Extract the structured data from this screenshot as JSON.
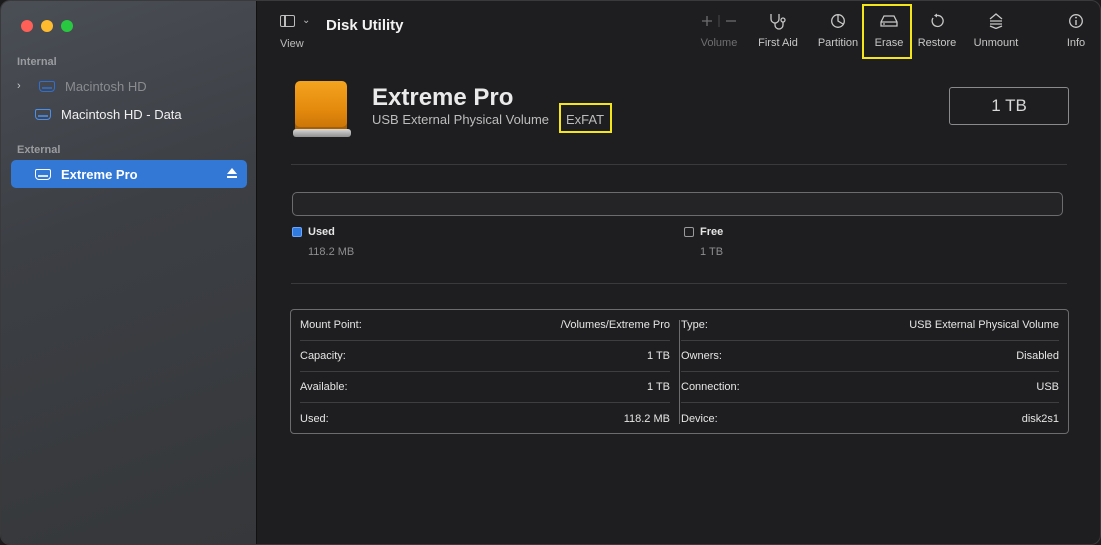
{
  "app": {
    "title": "Disk Utility"
  },
  "toolbar": {
    "view_label": "View",
    "volume_label": "Volume",
    "first_aid_label": "First Aid",
    "partition_label": "Partition",
    "erase_label": "Erase",
    "restore_label": "Restore",
    "unmount_label": "Unmount",
    "info_label": "Info"
  },
  "sidebar": {
    "internal_label": "Internal",
    "external_label": "External",
    "items": {
      "macintosh_hd": "Macintosh HD",
      "macintosh_hd_data": "Macintosh HD - Data",
      "extreme_pro": "Extreme Pro"
    }
  },
  "volume": {
    "name": "Extreme Pro",
    "subtitle": "USB External Physical Volume",
    "filesystem": "ExFAT",
    "capacity": "1 TB"
  },
  "usage": {
    "used_label": "Used",
    "used_value": "118.2 MB",
    "free_label": "Free",
    "free_value": "1 TB"
  },
  "info": {
    "left": [
      {
        "label": "Mount Point:",
        "value": "/Volumes/Extreme Pro"
      },
      {
        "label": "Capacity:",
        "value": "1 TB"
      },
      {
        "label": "Available:",
        "value": "1 TB"
      },
      {
        "label": "Used:",
        "value": "118.2 MB"
      }
    ],
    "right": [
      {
        "label": "Type:",
        "value": "USB External Physical Volume"
      },
      {
        "label": "Owners:",
        "value": "Disabled"
      },
      {
        "label": "Connection:",
        "value": "USB"
      },
      {
        "label": "Device:",
        "value": "disk2s1"
      }
    ]
  },
  "colors": {
    "accent": "#3478d6",
    "highlight": "#f5e61a",
    "drive_orange": "#e48a0d"
  }
}
